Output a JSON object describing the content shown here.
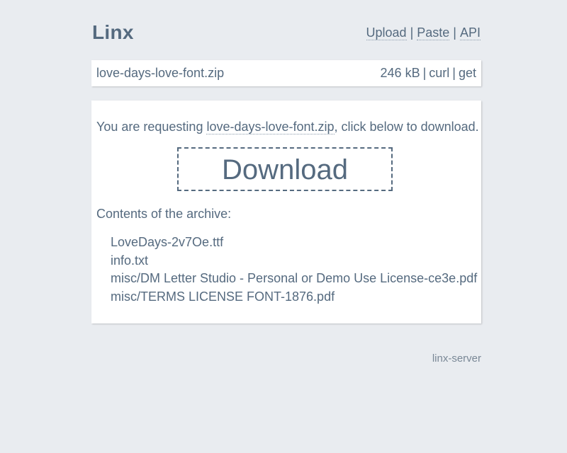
{
  "header": {
    "logo": "Linx",
    "nav": {
      "upload": "Upload",
      "paste": "Paste",
      "api": "API",
      "separator": "|"
    }
  },
  "filebar": {
    "filename": "love-days-love-font.zip",
    "size": "246 kB",
    "curl": "curl",
    "get": "get",
    "separator": "|"
  },
  "panel": {
    "request_prefix": "You are requesting ",
    "request_filename": "love-days-love-font.zip",
    "request_suffix": ", click below to download.",
    "download_label": "Download",
    "contents_title": "Contents of the archive:",
    "archive_files": [
      "LoveDays-2v7Oe.ttf",
      "info.txt",
      "misc/DM Letter Studio - Personal or Demo Use License-ce3e.pdf",
      "misc/TERMS LICENSE FONT-1876.pdf"
    ]
  },
  "footer": {
    "text": "linx-server"
  },
  "colors": {
    "background": "#e9ecf0",
    "text": "#556a7f",
    "card": "#ffffff",
    "footer_text": "#7a8896"
  }
}
